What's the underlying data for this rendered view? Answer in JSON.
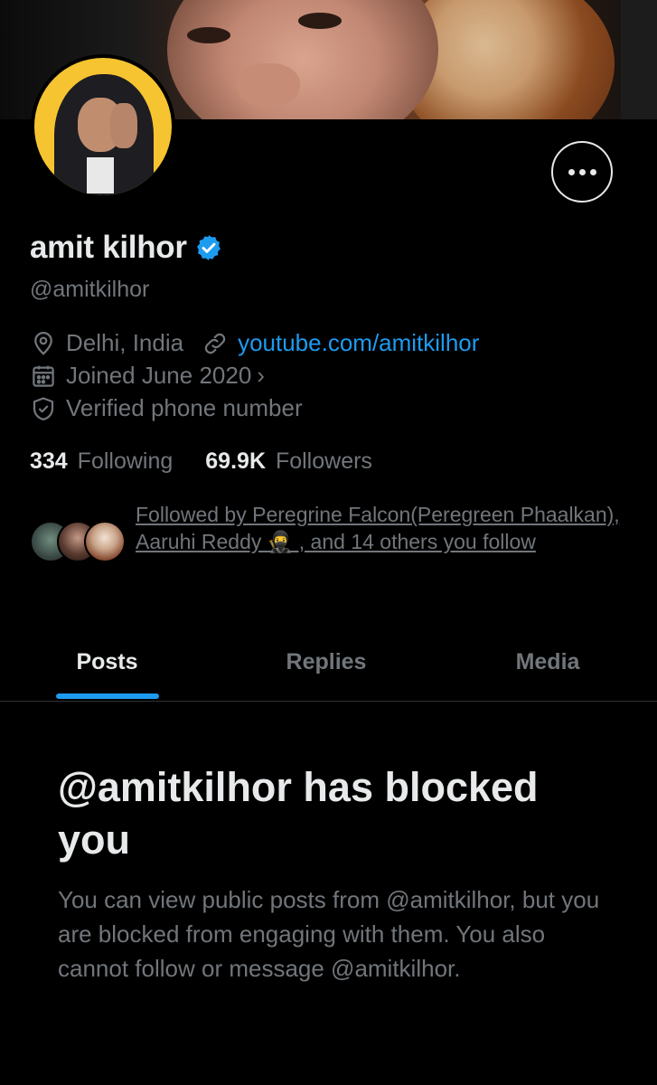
{
  "profile": {
    "name": "amit kilhor",
    "handle": "@amitkilhor",
    "location": "Delhi, India",
    "website": "youtube.com/amitkilhor",
    "joined": "Joined June 2020",
    "verified_phone": "Verified phone number",
    "following_count": "334",
    "following_label": "Following",
    "followers_count": "69.9K",
    "followers_label": "Followers",
    "followed_by": "Followed by Peregrine Falcon(Peregreen Phaalkan), Aaruhi Reddy 🥷 , and 14 others you follow"
  },
  "tabs": [
    {
      "label": "Posts",
      "active": true
    },
    {
      "label": "Replies",
      "active": false
    },
    {
      "label": "Media",
      "active": false
    }
  ],
  "blocked": {
    "title": "@amitkilhor has blocked you",
    "body": "You can view public posts from @amitkilhor, but you are blocked from engaging with them. You also cannot follow or message @amitkilhor."
  },
  "icons": {
    "more": "more-horizontal-icon",
    "verified": "verified-badge-icon",
    "location": "location-pin-icon",
    "link": "link-icon",
    "calendar": "calendar-icon",
    "shield": "shield-check-icon"
  },
  "colors": {
    "background": "#000000",
    "accent": "#1d9bf0",
    "text_primary": "#e7e9ea",
    "text_secondary": "#71767b",
    "avatar_bg": "#f6c431"
  }
}
